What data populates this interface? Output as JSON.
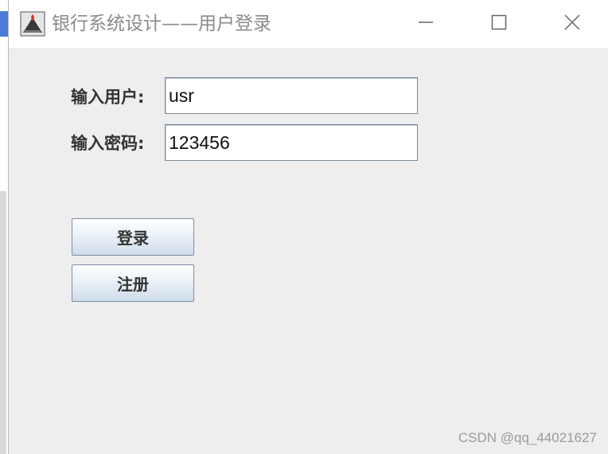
{
  "window": {
    "title": "银行系统设计——用户登录",
    "icon": "java-app-icon"
  },
  "window_controls": {
    "minimize_icon": "minimize-icon",
    "maximize_icon": "maximize-icon",
    "close_icon": "close-icon"
  },
  "form": {
    "user_label": "输入用户:",
    "user_value": "usr",
    "password_label": "输入密码:",
    "password_value": "123456"
  },
  "buttons": {
    "login_label": "登录",
    "register_label": "注册"
  },
  "watermark": "CSDN @qq_44021627",
  "colors": {
    "window_bg": "#eeeeee",
    "titlebar_bg": "#ffffff",
    "title_text": "#8a8a8a",
    "button_gradient_top": "#ffffff",
    "button_gradient_bottom": "#cfdcea",
    "field_border": "#7a8a99"
  }
}
